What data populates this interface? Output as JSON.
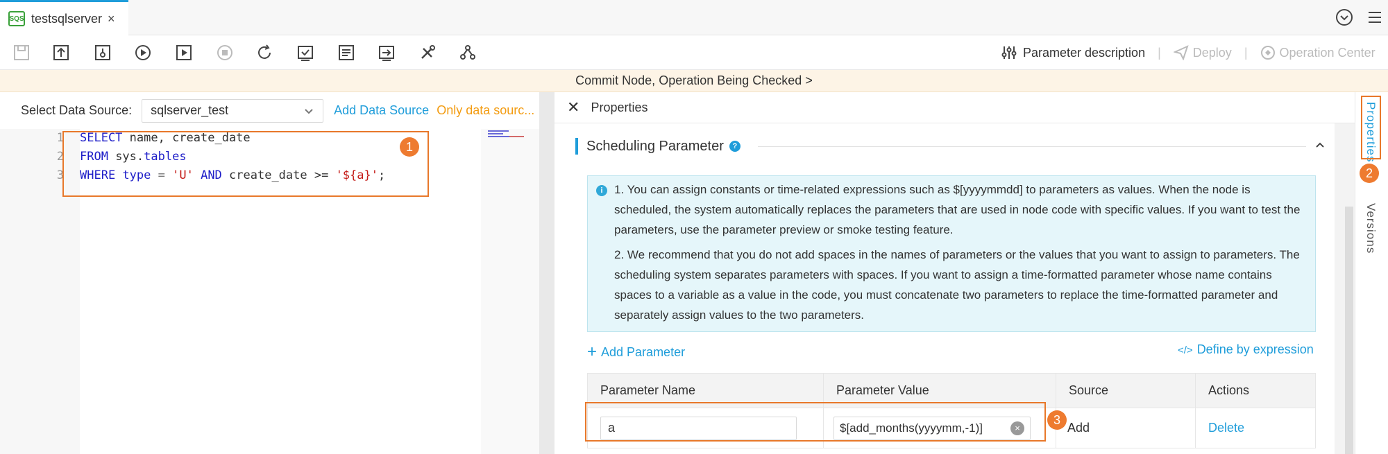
{
  "tab": {
    "icon_text": "SQS",
    "name": "testsqlserver",
    "close": "×"
  },
  "toolbar": {
    "param_desc": "Parameter description",
    "deploy": "Deploy",
    "op_center": "Operation Center",
    "separator": "|"
  },
  "banner": {
    "text": "Commit Node, Operation Being Checked >"
  },
  "datasource": {
    "label": "Select Data Source:",
    "selected": "sqlserver_test",
    "add": "Add Data Source",
    "warning": "Only data sourc..."
  },
  "editor": {
    "line_numbers": [
      "1",
      "2",
      "3"
    ],
    "lines": [
      [
        {
          "t": "SELECT",
          "c": "kw"
        },
        {
          "t": " name, create_date",
          "c": ""
        }
      ],
      [
        {
          "t": "FROM",
          "c": "kw"
        },
        {
          "t": " sys.",
          "c": ""
        },
        {
          "t": "tables",
          "c": "fn"
        }
      ],
      [
        {
          "t": "WHERE",
          "c": "kw"
        },
        {
          "t": " ",
          "c": ""
        },
        {
          "t": "type",
          "c": "fn"
        },
        {
          "t": " = ",
          "c": "op"
        },
        {
          "t": "'U'",
          "c": "str"
        },
        {
          "t": " ",
          "c": ""
        },
        {
          "t": "AND",
          "c": "kw"
        },
        {
          "t": " create_date >= ",
          "c": ""
        },
        {
          "t": "'${a}'",
          "c": "str"
        },
        {
          "t": ";",
          "c": ""
        }
      ]
    ]
  },
  "badges": {
    "one": "1",
    "two": "2",
    "three": "3"
  },
  "properties": {
    "title": "Properties",
    "close": "✕",
    "section_title": "Scheduling Parameter",
    "help": "?",
    "notice_p1": "1. You can assign constants or time-related expressions such as $[yyyymmdd] to parameters as values. When the node is scheduled, the system automatically replaces the parameters that are used in node code with specific values. If you want to test the parameters, use the parameter preview or smoke testing feature.",
    "notice_p2": "2. We recommend that you do not add spaces in the names of parameters or the values that you want to assign to parameters. The scheduling system separates parameters with spaces. If you want to assign a time-formatted parameter whose name contains spaces to a variable as a value in the code, you must concatenate two parameters to replace the time-formatted parameter and separately assign values to the two parameters.",
    "add_param": "Add Parameter",
    "define_expr": "Define by expression",
    "columns": [
      "Parameter Name",
      "Parameter Value",
      "Source",
      "Actions"
    ],
    "row": {
      "name": "a",
      "value": "$[add_months(yyyymm,-1)]",
      "source": "Add",
      "action": "Delete"
    }
  },
  "vtabs": {
    "properties": "Properties",
    "versions": "Versions"
  },
  "colors": {
    "accent": "#1f9dda",
    "callout": "#e8782a",
    "warning": "#f39c12"
  }
}
